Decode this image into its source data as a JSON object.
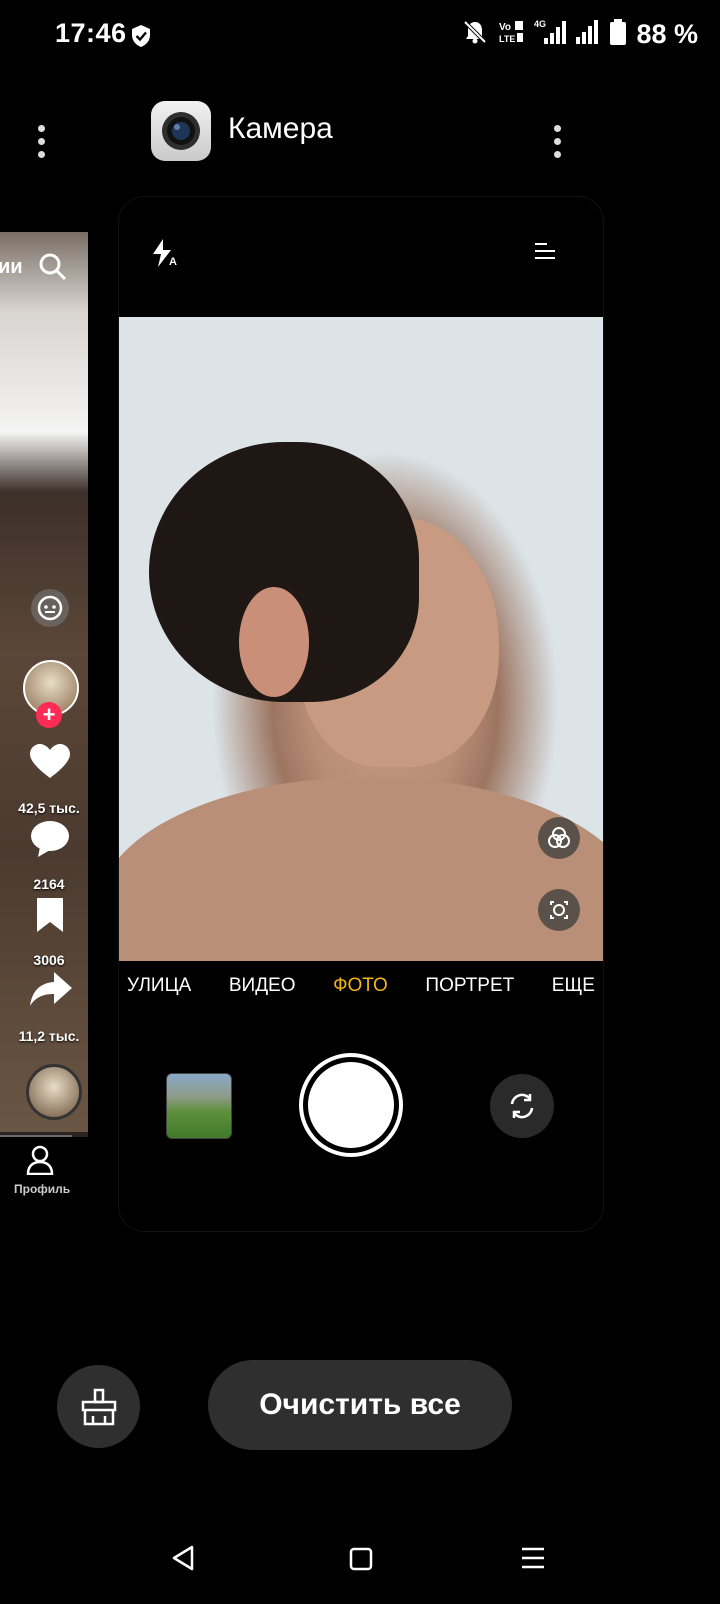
{
  "status_bar": {
    "time": "17:46",
    "battery": "88 %",
    "icons": [
      "shield-icon",
      "bell-muted-icon",
      "volte-icon",
      "signal-4g-icon",
      "signal-icon",
      "battery-icon"
    ]
  },
  "tiktok_card": {
    "partial_header_text": "ии",
    "likes": "42,5 тыс.",
    "comments": "2164",
    "saves": "3006",
    "shares": "11,2 тыс.",
    "nav_profile_label": "Профиль"
  },
  "camera_card": {
    "app_title": "Камера",
    "modes": [
      {
        "label": "УЛИЦА",
        "active": false
      },
      {
        "label": "ВИДЕО",
        "active": false
      },
      {
        "label": "ФОТО",
        "active": true
      },
      {
        "label": "ПОРТРЕТ",
        "active": false
      },
      {
        "label": "ЕЩЕ",
        "active": false
      }
    ]
  },
  "actions": {
    "clear_all_label": "Очистить все"
  },
  "colors": {
    "active_mode": "#f2b31b",
    "background": "#000000",
    "button_bg": "#2f2f2f",
    "tiktok_follow": "#fe2c55"
  }
}
